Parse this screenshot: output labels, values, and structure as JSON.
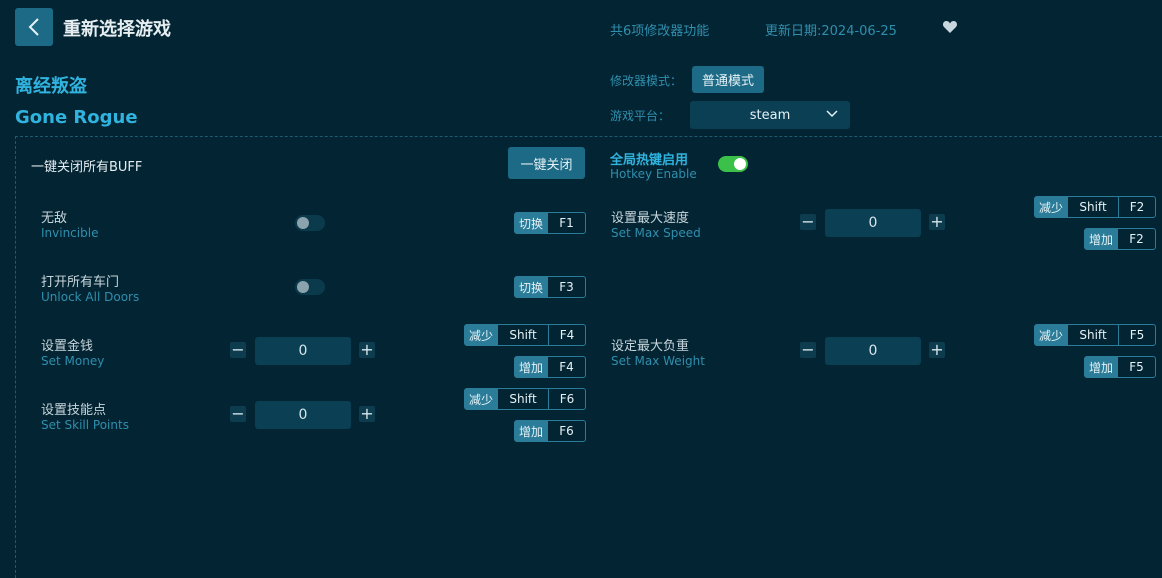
{
  "header": {
    "title": "重新选择游戏",
    "feature_count": "共6项修改器功能",
    "update_date": "更新日期:2024-06-25"
  },
  "game": {
    "name_cn": "离经叛盗",
    "name_en": "Gone Rogue"
  },
  "mode": {
    "label": "修改器模式：",
    "value": "普通模式"
  },
  "platform": {
    "label": "游戏平台：",
    "value": "steam"
  },
  "controls": {
    "close_all_label": "一键关闭所有BUFF",
    "close_all_button": "一键关闭",
    "hotkey_cn": "全局热键启用",
    "hotkey_en": "Hotkey Enable",
    "hotkey_enabled": true
  },
  "cheats": [
    {
      "cn": "无敌",
      "en": "Invincible",
      "type": "toggle",
      "on": false,
      "keys": [
        {
          "tag": "切换",
          "key": "F1"
        }
      ]
    },
    {
      "cn": "打开所有车门",
      "en": "Unlock All Doors",
      "type": "toggle",
      "on": false,
      "keys": [
        {
          "tag": "切换",
          "key": "F3"
        }
      ]
    },
    {
      "cn": "设置金钱",
      "en": "Set Money",
      "type": "number",
      "value": "0",
      "keys": [
        {
          "tag": "减少",
          "mod": "Shift",
          "key": "F4"
        },
        {
          "tag": "增加",
          "key": "F4"
        }
      ]
    },
    {
      "cn": "设置技能点",
      "en": "Set Skill Points",
      "type": "number",
      "value": "0",
      "keys": [
        {
          "tag": "减少",
          "mod": "Shift",
          "key": "F6"
        },
        {
          "tag": "增加",
          "key": "F6"
        }
      ]
    },
    {
      "cn": "设置最大速度",
      "en": "Set Max Speed",
      "type": "number",
      "value": "0",
      "keys": [
        {
          "tag": "减少",
          "mod": "Shift",
          "key": "F2"
        },
        {
          "tag": "增加",
          "key": "F2"
        }
      ]
    },
    {
      "cn": "设定最大负重",
      "en": "Set Max Weight",
      "type": "number",
      "value": "0",
      "keys": [
        {
          "tag": "减少",
          "mod": "Shift",
          "key": "F5"
        },
        {
          "tag": "增加",
          "key": "F5"
        }
      ]
    }
  ],
  "step": {
    "minus": "−",
    "plus": "+"
  },
  "colors": {
    "background": "#032432",
    "accent": "#1d6a86",
    "title_blue": "#30b4df",
    "toggle_on": "#3bc14a"
  }
}
